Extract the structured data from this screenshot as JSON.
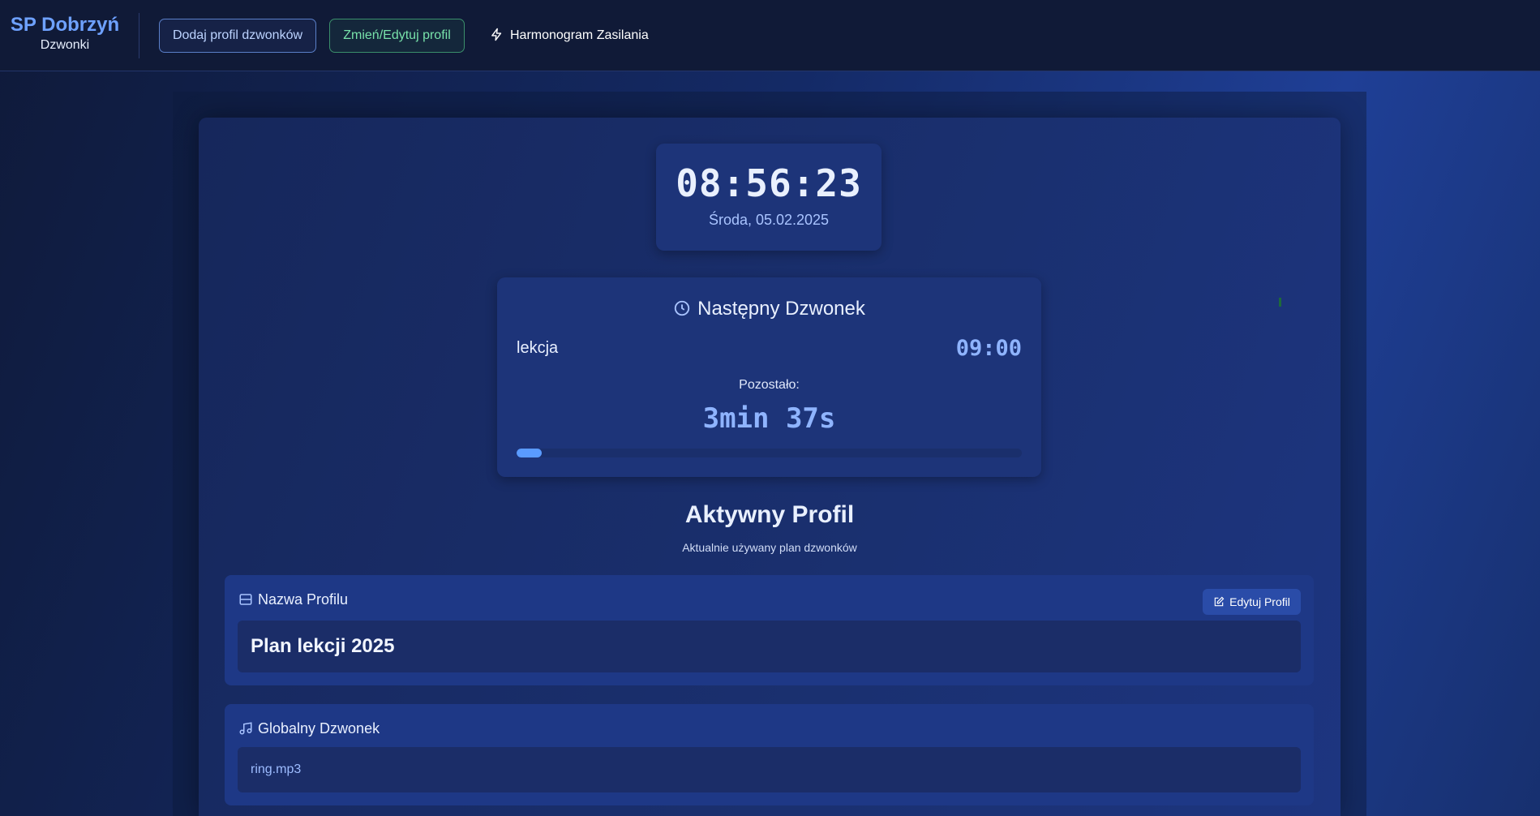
{
  "header": {
    "brand_title": "SP Dobrzyń",
    "brand_subtitle": "Dzwonki",
    "add_profile_label": "Dodaj profil dzwonków",
    "edit_profile_label": "Zmień/Edytuj profil",
    "power_schedule_label": "Harmonogram Zasilania"
  },
  "clock": {
    "time": "08:56:23",
    "date": "Środa, 05.02.2025"
  },
  "next_bell": {
    "heading": "Następny Dzwonek",
    "label": "lekcja",
    "time": "09:00",
    "remaining_label": "Pozostało:",
    "remaining_value": "3min 37s",
    "progress_percent": 5
  },
  "active_profile": {
    "title": "Aktywny Profil",
    "subtitle": "Aktualnie używany plan dzwonków",
    "profile_name_heading": "Nazwa Profilu",
    "edit_button_label": "Edytuj Profil",
    "profile_name": "Plan lekcji 2025",
    "global_bell_heading": "Globalny Dzwonek",
    "global_bell_file": "ring.mp3"
  },
  "colors": {
    "accent": "#6ea1ff",
    "progress": "#5a9bff",
    "edit_green": "#78e2aa"
  }
}
